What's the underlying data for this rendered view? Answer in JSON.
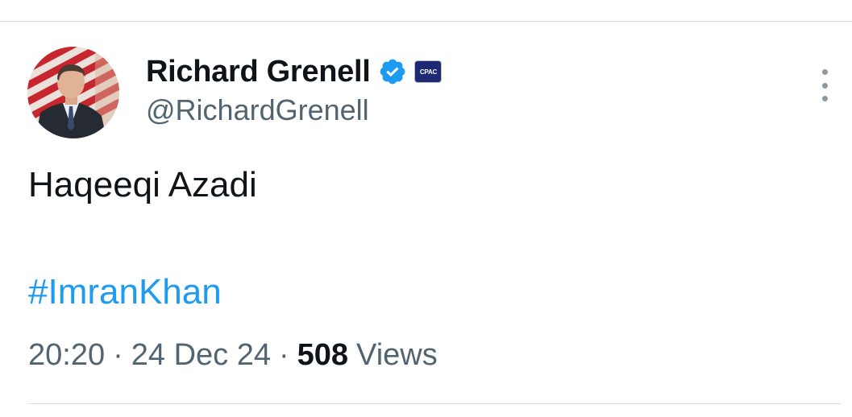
{
  "author": {
    "display_name": "Richard Grenell",
    "handle": "@RichardGrenell",
    "verified_icon": "verified-badge-icon",
    "affiliate_badge_icon": "cpac-affiliate-icon",
    "affiliate_badge_text": "CPAC",
    "avatar_icon": "avatar-photo"
  },
  "tweet": {
    "text": "Haqeeqi Azadi",
    "hashtag": "#ImranKhan"
  },
  "meta": {
    "time": "20:20",
    "separator": "·",
    "date": "24 Dec 24",
    "views_count": "508",
    "views_label": "Views"
  },
  "menu": {
    "more_icon": "more-vertical-icon"
  },
  "colors": {
    "text_primary": "#0f1419",
    "text_secondary": "#536471",
    "link": "#1d9bf0",
    "verified": "#1d9bf0",
    "divider": "#d8dde2"
  }
}
